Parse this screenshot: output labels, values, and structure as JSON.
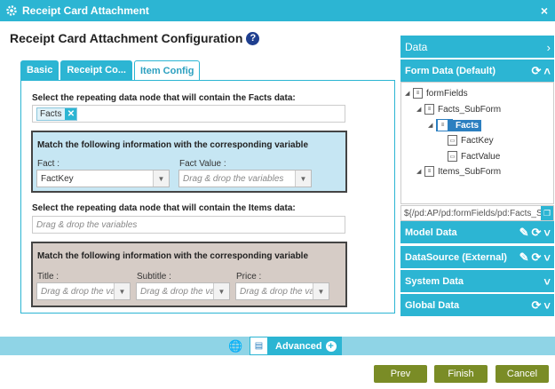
{
  "window": {
    "title": "Receipt Card Attachment"
  },
  "page": {
    "title": "Receipt Card Attachment Configuration",
    "help": "?"
  },
  "tabs": [
    {
      "label": "Basic"
    },
    {
      "label": "Receipt Co..."
    },
    {
      "label": "Item Config"
    }
  ],
  "facts": {
    "node_label": "Select the repeating data node that will contain the Facts data:",
    "chip": "Facts",
    "chip_remove": "✕",
    "match_title": "Match the following information with the corresponding variable",
    "fact_label": "Fact :",
    "fact_value": "FactKey",
    "fact_value_label": "Fact Value :",
    "fact_value_placeholder": "Drag & drop the variables"
  },
  "items": {
    "node_label": "Select the repeating data node that will contain the Items data:",
    "node_placeholder": "Drag & drop the variables",
    "match_title": "Match the following information with the corresponding variable",
    "title_label": "Title :",
    "subtitle_label": "Subtitle :",
    "price_label": "Price :",
    "placeholder": "Drag & drop the vari"
  },
  "right_panel": {
    "data_header": "Data",
    "form_data_header": "Form Data (Default)",
    "tree": [
      {
        "label": "formFields"
      },
      {
        "label": "Facts_SubForm"
      },
      {
        "label": "Facts"
      },
      {
        "label": "FactKey"
      },
      {
        "label": "FactValue"
      },
      {
        "label": "Items_SubForm"
      }
    ],
    "path": "${/pd:AP/pd:formFields/pd:Facts_SubForm/pd:Facts}",
    "sections": [
      {
        "label": "Model Data"
      },
      {
        "label": "DataSource (External)"
      },
      {
        "label": "System Data"
      },
      {
        "label": "Global Data"
      }
    ]
  },
  "bottom": {
    "advanced": "Advanced",
    "plus": "+"
  },
  "buttons": {
    "prev": "Prev",
    "finish": "Finish",
    "cancel": "Cancel"
  },
  "colors": {
    "accent": "#2cb5d3",
    "button": "#7a8c26",
    "facts_box": "#c6e6f3",
    "items_box": "#d6ccc6"
  }
}
